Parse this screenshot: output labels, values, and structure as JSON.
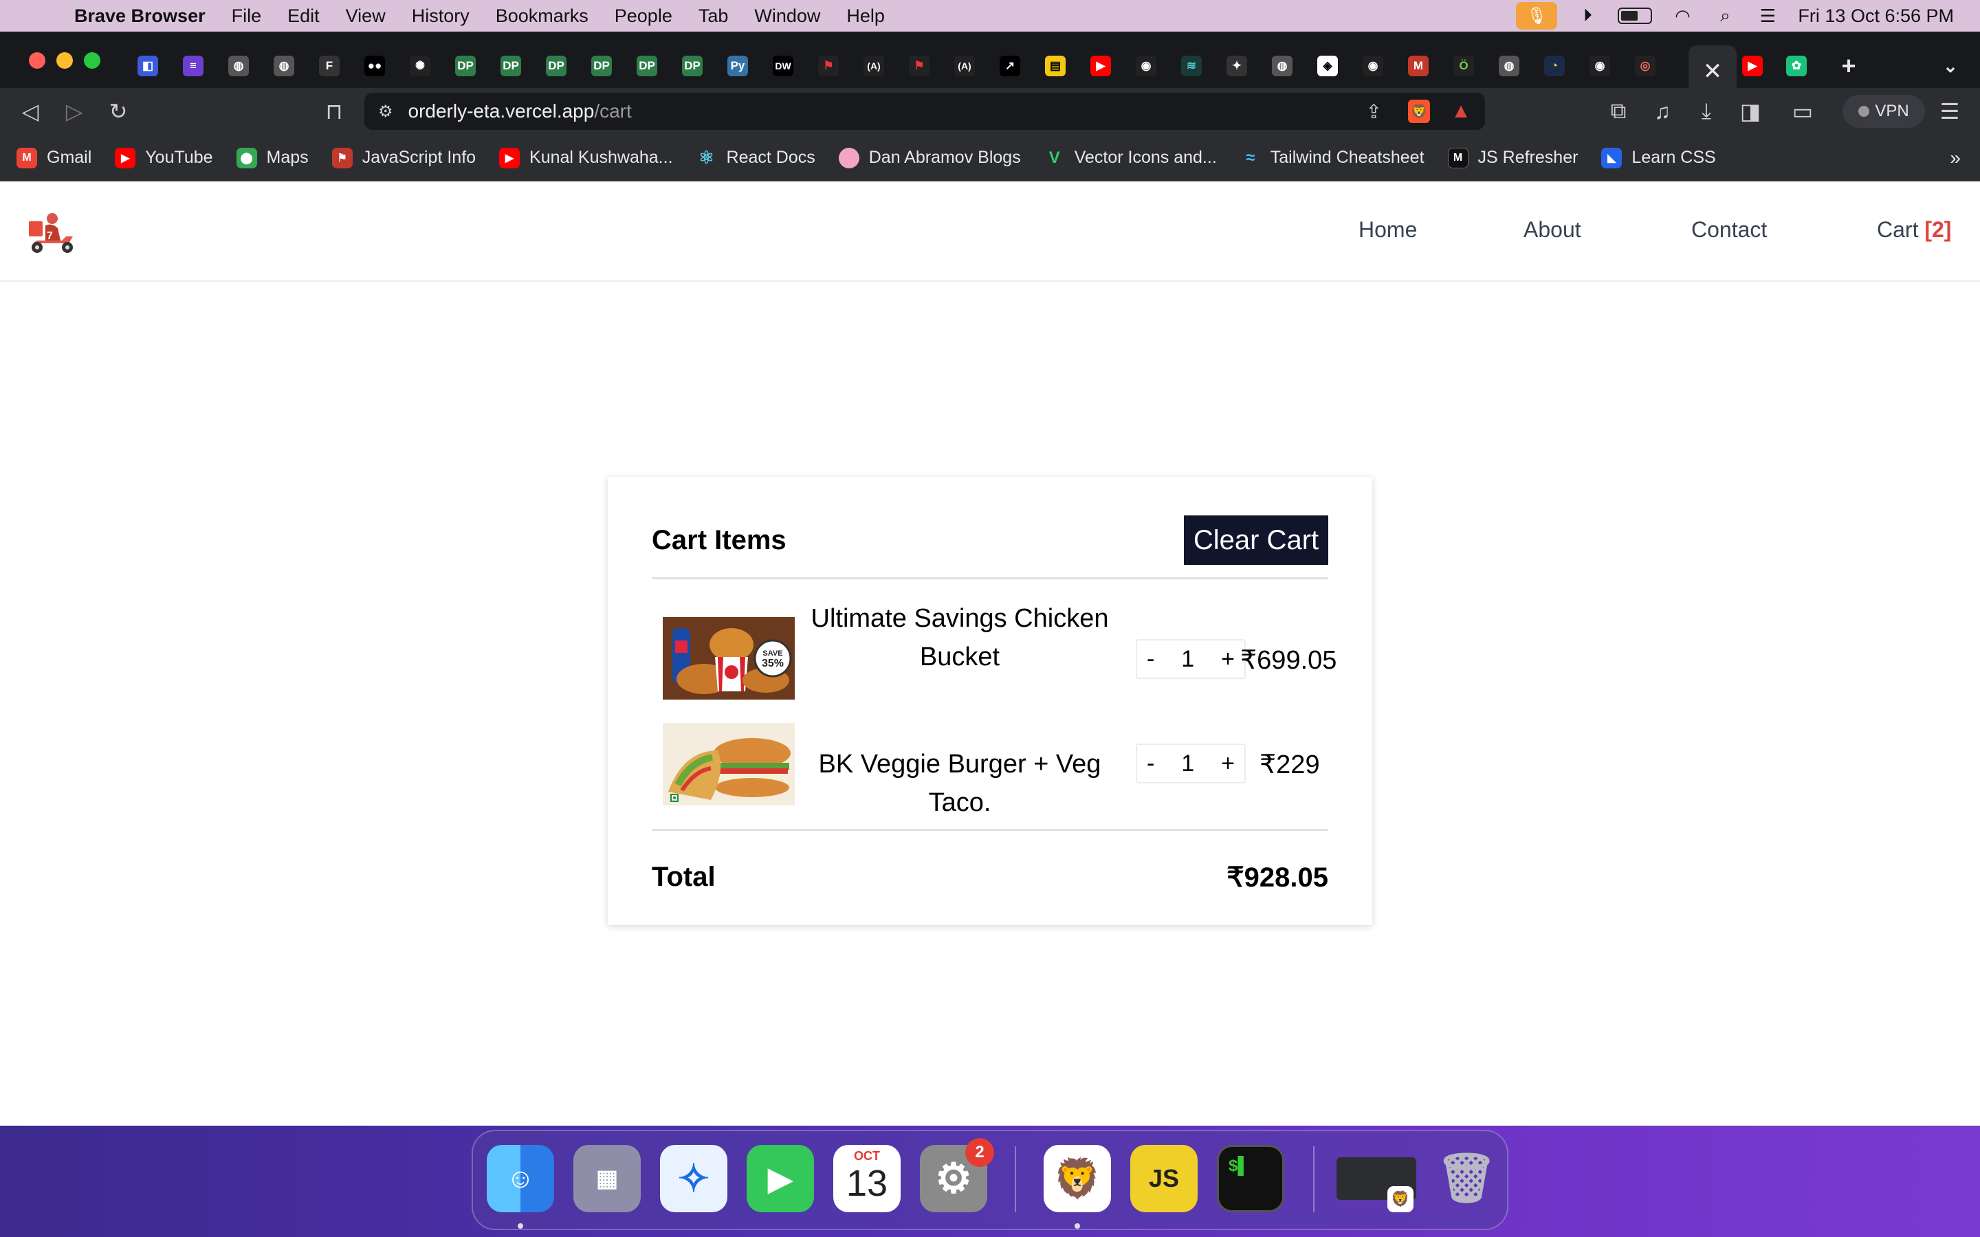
{
  "menubar": {
    "app_name": "Brave Browser",
    "items": [
      "File",
      "Edit",
      "View",
      "History",
      "Bookmarks",
      "People",
      "Tab",
      "Window",
      "Help"
    ],
    "datetime": "Fri 13 Oct  6:56 PM"
  },
  "browser": {
    "url_host": "orderly-eta.vercel.app",
    "url_path": "/cart",
    "vpn_label": "VPN",
    "bookmarks": [
      {
        "label": "Gmail",
        "color": "#ea4335",
        "icon": "M"
      },
      {
        "label": "YouTube",
        "color": "#ff0000",
        "icon": "▶"
      },
      {
        "label": "Maps",
        "color": "#34a853",
        "icon": "⬤"
      },
      {
        "label": "JavaScript Info",
        "color": "#c0392b",
        "icon": "⚑"
      },
      {
        "label": "Kunal Kushwaha...",
        "color": "#ff0000",
        "icon": "▶"
      },
      {
        "label": "React Docs",
        "color": "#58c4dc",
        "icon": "⚛"
      },
      {
        "label": "Dan Abramov Blogs",
        "color": "#f4a6c0",
        "icon": "●"
      },
      {
        "label": "Vector Icons and...",
        "color": "#2ecc71",
        "icon": "V"
      },
      {
        "label": "Tailwind Cheatsheet",
        "color": "#38bdf8",
        "icon": "≈"
      },
      {
        "label": "JS Refresher",
        "color": "#111111",
        "icon": "M"
      },
      {
        "label": "Learn CSS",
        "color": "#2563eb",
        "icon": "◣"
      }
    ],
    "more_bookmarks": "»"
  },
  "navbar": {
    "links": [
      "Home",
      "About",
      "Contact"
    ],
    "cart_label": "Cart",
    "cart_count": "[2]"
  },
  "cart": {
    "title": "Cart Items",
    "clear_label": "Clear Cart",
    "items": [
      {
        "name": "Ultimate Savings Chicken Bucket",
        "quantity": "1",
        "price": "₹699.05",
        "minus": "-",
        "plus": "+"
      },
      {
        "name": "BK Veggie Burger + Veg Taco.",
        "quantity": "1",
        "price": "₹229",
        "minus": "-",
        "plus": "+"
      }
    ],
    "total_label": "Total",
    "total_value": "₹928.05",
    "promo_badge": {
      "line1": "SAVE",
      "line2": "35%"
    }
  },
  "dock": {
    "calendar_month": "OCT",
    "calendar_day": "13",
    "settings_badge": "2"
  }
}
